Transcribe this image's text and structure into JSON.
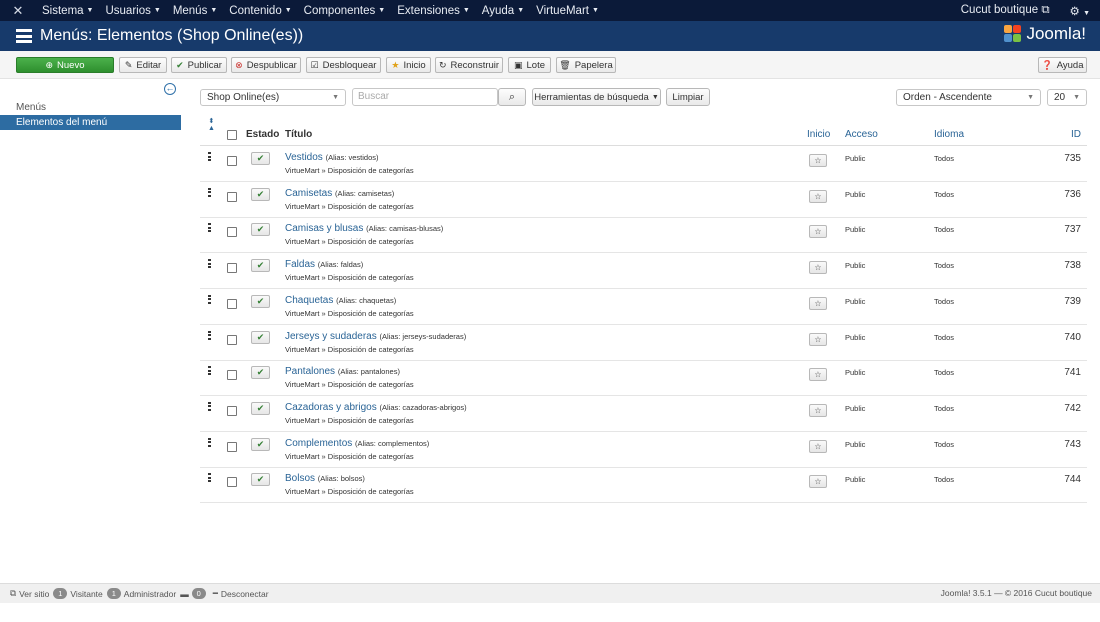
{
  "topnav": {
    "logo_icon": "joomla-x-icon",
    "menus": [
      "Sistema",
      "Usuarios",
      "Menús",
      "Contenido",
      "Componentes",
      "Extensiones",
      "Ayuda",
      "VirtueMart"
    ],
    "site_label": "Cucut boutique",
    "site_link_icon": "external-link-icon",
    "settings_icon": "gear-icon"
  },
  "header": {
    "title": "Menús: Elementos (Shop Online(es))",
    "brand": "Joomla!",
    "list_icon": "list-icon"
  },
  "toolbar": {
    "nuevo": "Nuevo",
    "editar": "Editar",
    "publicar": "Publicar",
    "despublicar": "Despublicar",
    "desbloquear": "Desbloquear",
    "inicio": "Inicio",
    "reconstruir": "Reconstruir",
    "lote": "Lote",
    "papelera": "Papelera",
    "ayuda": "Ayuda"
  },
  "sidebar": {
    "heading": "Menús",
    "active_item": "Elementos del menú"
  },
  "filters": {
    "menu_select": "Shop Online(es)",
    "search_placeholder": "Buscar",
    "search_tools": "Herramientas de búsqueda",
    "clear": "Limpiar",
    "ordering": "Orden - Ascendente",
    "limit": "20"
  },
  "table": {
    "headers": {
      "estado": "Estado",
      "titulo": "Título",
      "inicio": "Inicio",
      "acceso": "Acceso",
      "idioma": "Idioma",
      "id": "ID"
    },
    "alias_prefix": "(Alias: ",
    "rows": [
      {
        "title": "Vestidos",
        "alias": "vestidos",
        "type": "VirtueMart » Disposición de categorías",
        "access": "Public",
        "language": "Todos",
        "id": "735"
      },
      {
        "title": "Camisetas",
        "alias": "camisetas",
        "type": "VirtueMart » Disposición de categorías",
        "access": "Public",
        "language": "Todos",
        "id": "736"
      },
      {
        "title": "Camisas y blusas",
        "alias": "camisas-blusas",
        "type": "VirtueMart » Disposición de categorías",
        "access": "Public",
        "language": "Todos",
        "id": "737"
      },
      {
        "title": "Faldas",
        "alias": "faldas",
        "type": "VirtueMart » Disposición de categorías",
        "access": "Public",
        "language": "Todos",
        "id": "738"
      },
      {
        "title": "Chaquetas",
        "alias": "chaquetas",
        "type": "VirtueMart » Disposición de categorías",
        "access": "Public",
        "language": "Todos",
        "id": "739"
      },
      {
        "title": "Jerseys y sudaderas",
        "alias": "jerseys-sudaderas",
        "type": "VirtueMart » Disposición de categorías",
        "access": "Public",
        "language": "Todos",
        "id": "740"
      },
      {
        "title": "Pantalones",
        "alias": "pantalones",
        "type": "VirtueMart » Disposición de categorías",
        "access": "Public",
        "language": "Todos",
        "id": "741"
      },
      {
        "title": "Cazadoras y abrigos",
        "alias": "cazadoras-abrigos",
        "type": "VirtueMart » Disposición de categorías",
        "access": "Public",
        "language": "Todos",
        "id": "742"
      },
      {
        "title": "Complementos",
        "alias": "complementos",
        "type": "VirtueMart » Disposición de categorías",
        "access": "Public",
        "language": "Todos",
        "id": "743"
      },
      {
        "title": "Bolsos",
        "alias": "bolsos",
        "type": "VirtueMart » Disposición de categorías",
        "access": "Public",
        "language": "Todos",
        "id": "744"
      }
    ]
  },
  "footer": {
    "view_site": "Ver sitio",
    "visitors_count": "1",
    "visitors_label": "Visitante",
    "admins_count": "1",
    "admins_label": "Administrador",
    "messages_count": "0",
    "logout": "Desconectar",
    "version": "Joomla! 3.5.1 — © 2016 Cucut boutique"
  },
  "colors": {
    "topnav_bg": "#0b1a39",
    "header_bg": "#173a6b",
    "accent": "#2d6ca2",
    "new_button": "#3a9f3a"
  }
}
